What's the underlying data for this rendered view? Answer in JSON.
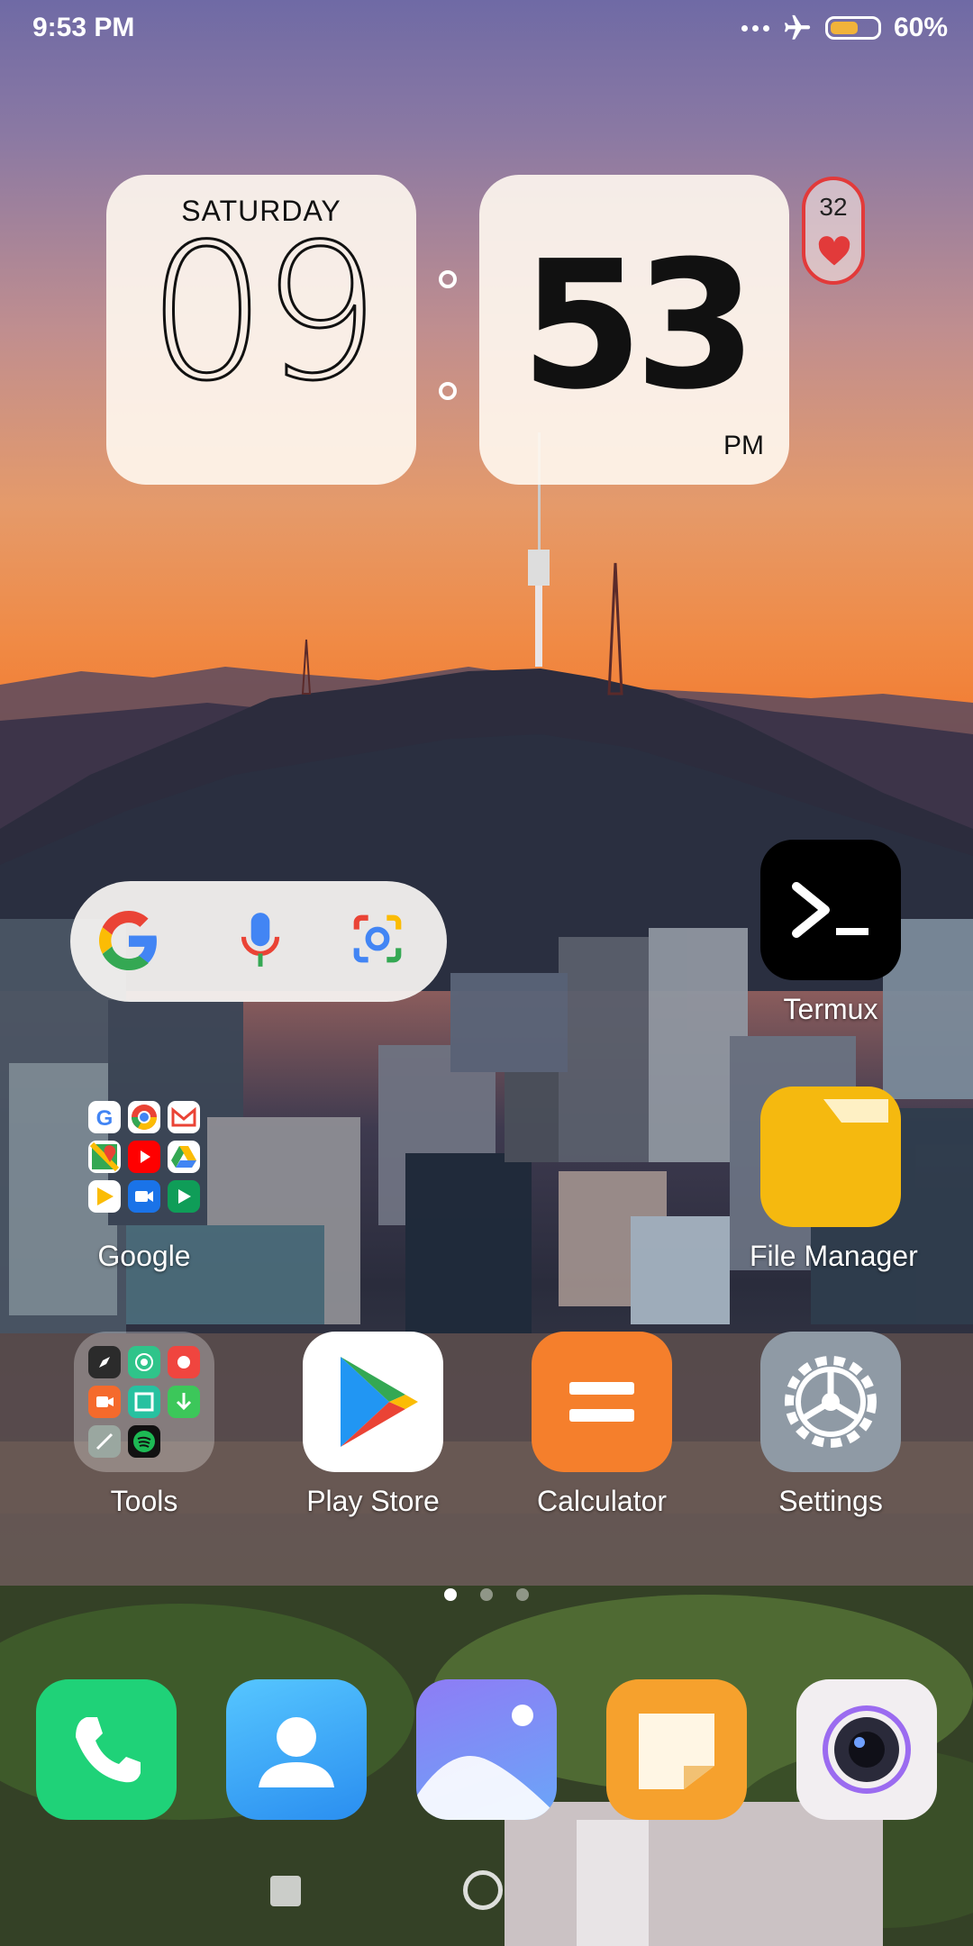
{
  "status_bar": {
    "time": "9:53 PM",
    "more_icon": "more-dots-icon",
    "airplane_icon": "airplane-mode-icon",
    "battery_icon": "battery-icon",
    "battery_level": 0.6,
    "battery_text": "60%"
  },
  "clock_widget": {
    "weekday": "SATURDAY",
    "hours": "09",
    "minutes": "53",
    "ampm": "PM"
  },
  "health_widget": {
    "value": "32",
    "icon": "heart-icon",
    "color": "#e23a3a"
  },
  "search_widget": {
    "google_icon": "google-g-icon",
    "voice_icon": "microphone-icon",
    "lens_icon": "google-lens-icon"
  },
  "apps": {
    "termux": {
      "label": "Termux",
      "icon": "terminal-icon"
    },
    "file_manager": {
      "label": "File Manager",
      "icon": "folder-icon"
    },
    "google_folder": {
      "label": "Google",
      "icon": "folder-grid-icon"
    },
    "tools_folder": {
      "label": "Tools",
      "icon": "folder-grid-icon"
    },
    "play_store": {
      "label": "Play Store",
      "icon": "play-store-icon"
    },
    "calculator": {
      "label": "Calculator",
      "icon": "calculator-icon"
    },
    "settings": {
      "label": "Settings",
      "icon": "gear-icon"
    }
  },
  "page_indicator": {
    "pages": 3,
    "current": 1
  },
  "dock": [
    {
      "name": "phone",
      "icon": "phone-icon"
    },
    {
      "name": "contacts",
      "icon": "contacts-icon"
    },
    {
      "name": "gallery",
      "icon": "gallery-icon"
    },
    {
      "name": "notes",
      "icon": "notes-icon"
    },
    {
      "name": "camera",
      "icon": "camera-icon"
    }
  ],
  "colors": {
    "termux_bg": "#000000",
    "file_manager_bg": "#f5b90f",
    "calculator_bg": "#f57f2c",
    "settings_bg": "#8f9aa5",
    "phone_bg": "#1fd278",
    "contacts_bg": "#3aa3f5",
    "notes_bg": "#f6a12d"
  }
}
